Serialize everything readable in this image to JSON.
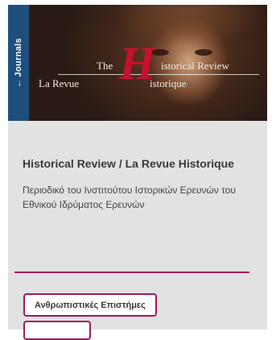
{
  "card": {
    "badge_label": "Journals",
    "logo": {
      "line1_left": "The",
      "line1_right": "istorical Review",
      "line2_left": "La Revue",
      "line2_right": "istorique",
      "initial": "H"
    },
    "title": "Historical Review / La Revue Historique",
    "description": "Περιοδικό του Ινστιτούτου Ιστορικών Ερευνών του Εθνικού Ιδρύματος Ερευνών",
    "tags": [
      "Ανθρωπιστικές Επιστήμες"
    ]
  },
  "colors": {
    "accent": "#a3195b",
    "badge_bg": "#1d4f7c",
    "card_bg": "#e2e2e2",
    "logo_initial": "#c8102e"
  }
}
